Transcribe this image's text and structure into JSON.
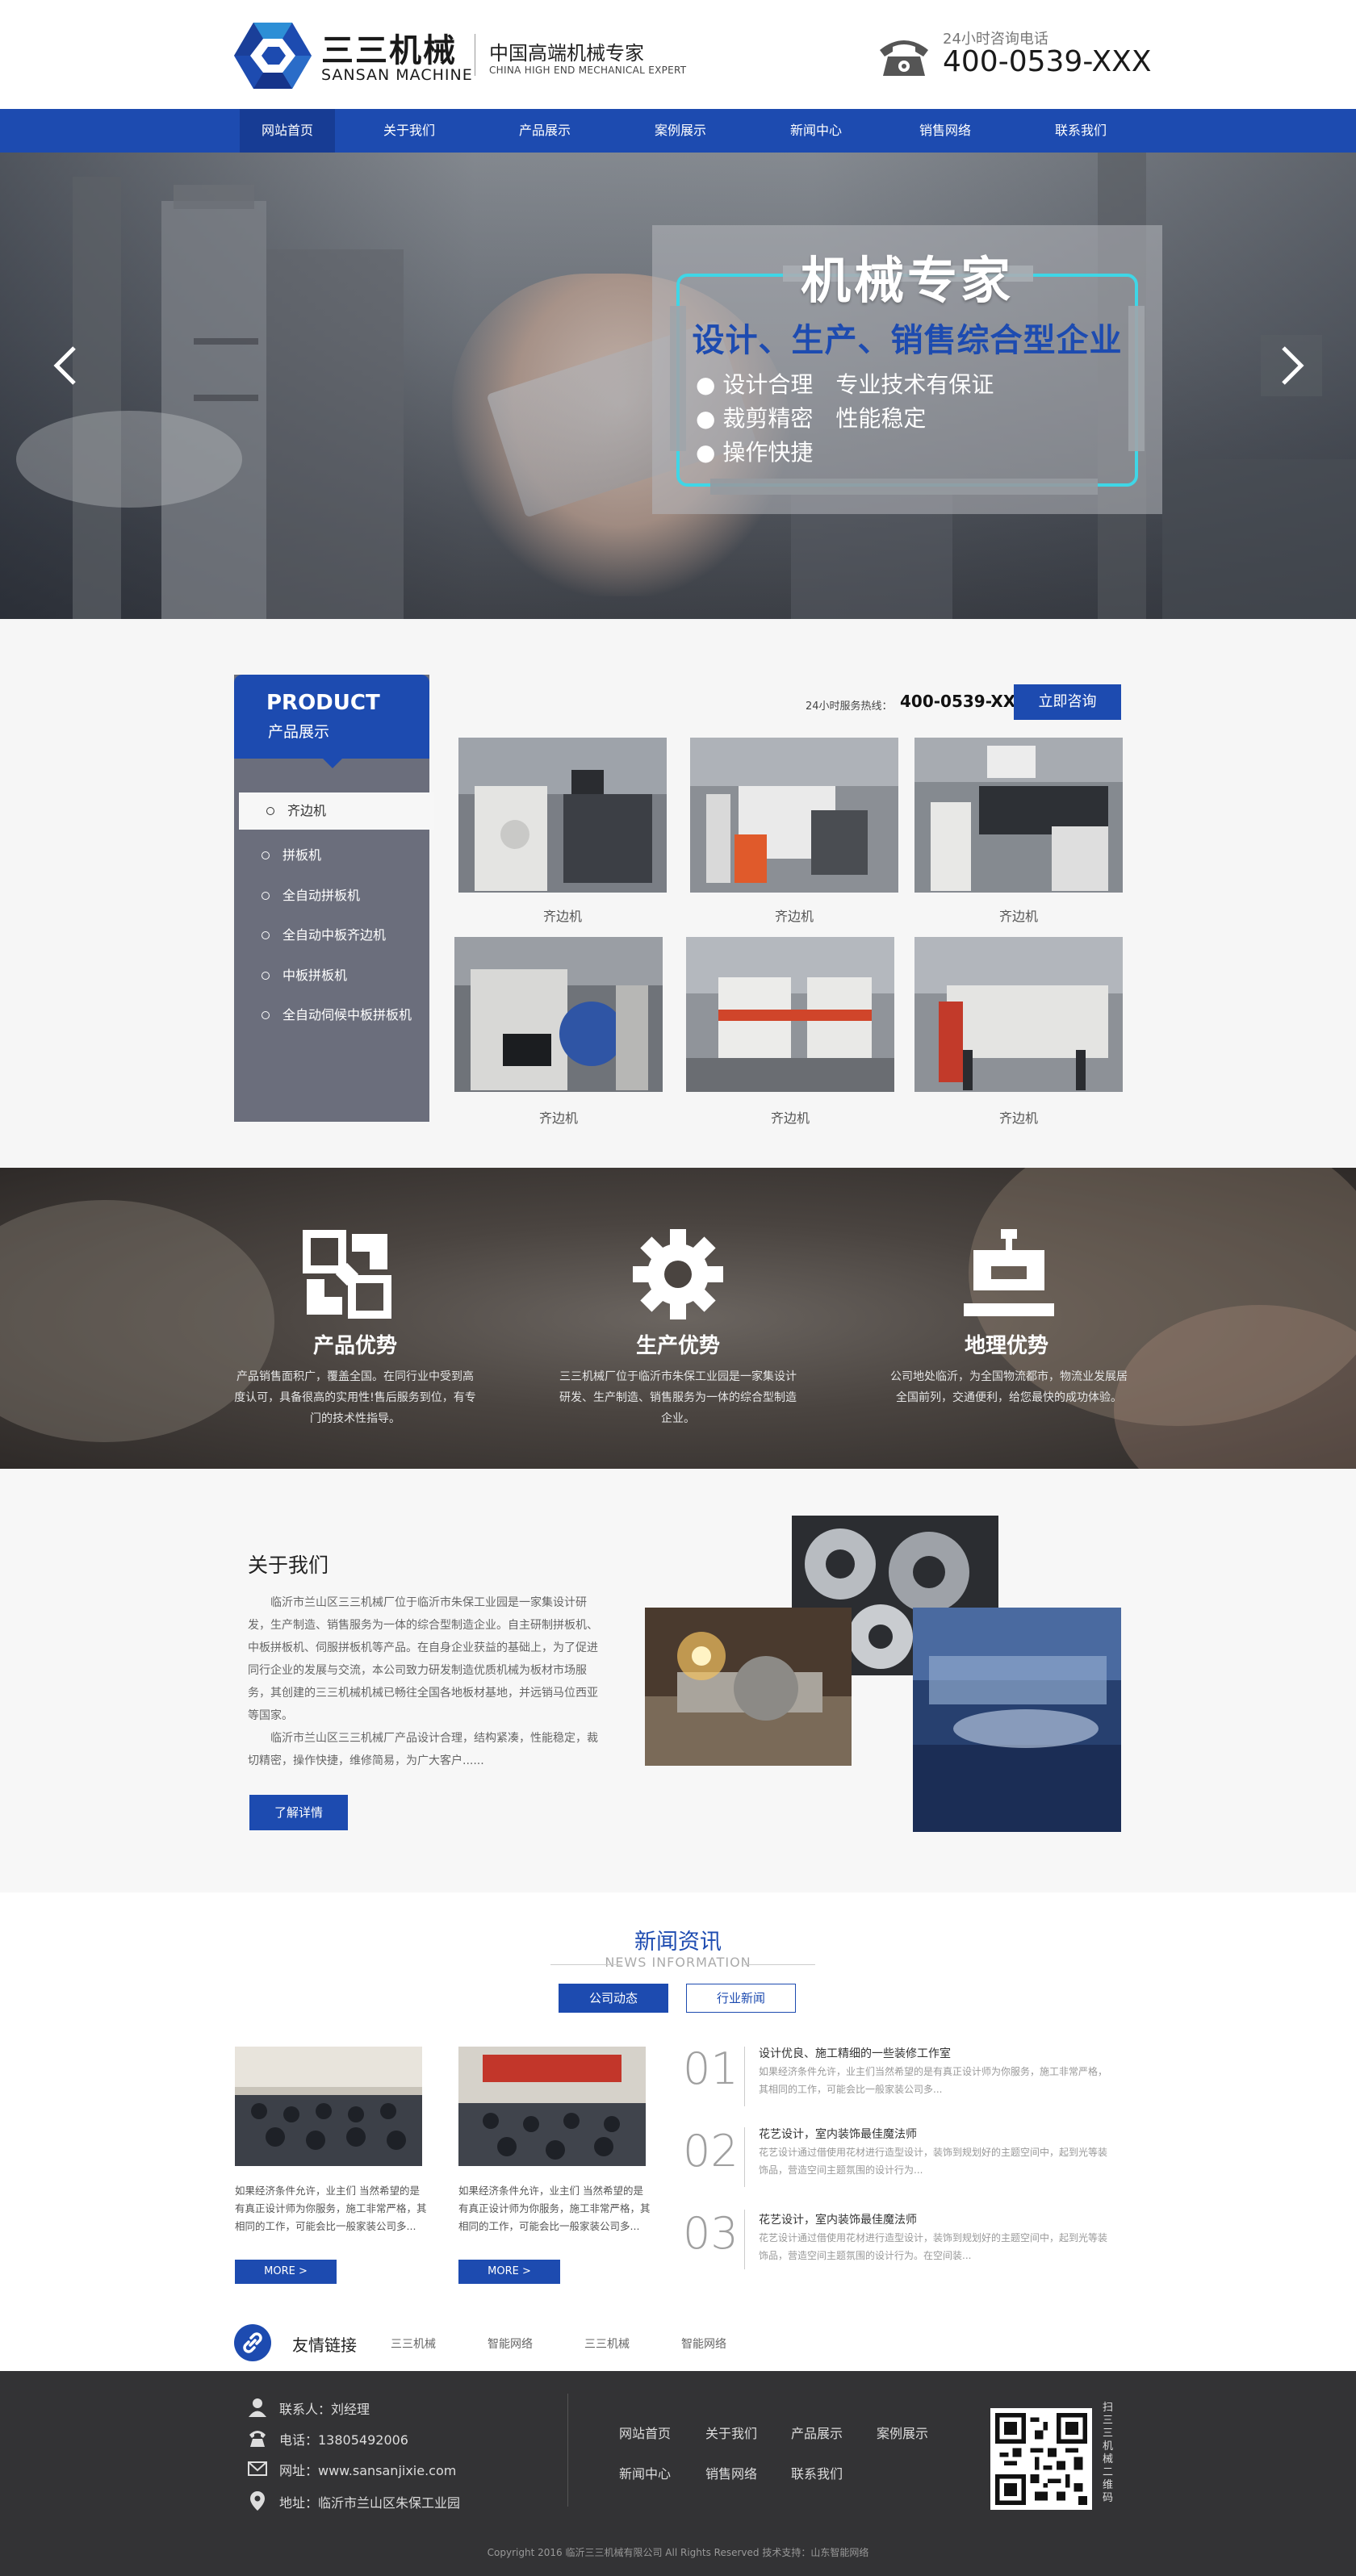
{
  "header": {
    "brand_cn": "三三机械",
    "brand_en": "SANSAN MACHINE",
    "slogan_cn": "中国高端机械专家",
    "slogan_en": "CHINA HIGH END MECHANICAL EXPERT",
    "hotline_label": "24小时咨询电话",
    "hotline_number": "400-0539-XXX"
  },
  "nav": {
    "items": [
      {
        "label": "网站首页",
        "active": true
      },
      {
        "label": "关于我们"
      },
      {
        "label": "产品展示"
      },
      {
        "label": "案例展示"
      },
      {
        "label": "新闻中心"
      },
      {
        "label": "销售网络"
      },
      {
        "label": "联系我们"
      }
    ]
  },
  "banner": {
    "title": "机械专家",
    "subtitle": "设计、生产、销售综合型企业",
    "bullets": [
      "● 设计合理　专业技术有保证",
      "● 裁剪精密　性能稳定",
      "● 操作快捷"
    ]
  },
  "products": {
    "side_title_en": "PRODUCT",
    "side_title_cn": "产品展示",
    "categories": [
      "齐边机",
      "拼板机",
      "全自动拼板机",
      "全自动中板齐边机",
      "中板拼板机",
      "全自动伺候中板拼板机"
    ],
    "service_label": "24小时服务热线：",
    "service_number": "400-0539-XXX",
    "consult_button": "立即咨询",
    "items": [
      {
        "caption": "齐边机"
      },
      {
        "caption": "齐边机"
      },
      {
        "caption": "齐边机"
      },
      {
        "caption": "齐边机"
      },
      {
        "caption": "齐边机"
      },
      {
        "caption": "齐边机"
      }
    ]
  },
  "advantages": [
    {
      "icon": "product-advantage-icon",
      "title": "产品优势",
      "text": "产品销售面积广，覆盖全国。在同行业中受到高度认可，具备很高的实用性!售后服务到位，有专门的技术性指导。"
    },
    {
      "icon": "gear-icon",
      "title": "生产优势",
      "text": "三三机械厂位于临沂市朱保工业园是一家集设计研发、生产制造、销售服务为一体的综合型制造企业。"
    },
    {
      "icon": "location-icon",
      "title": "地理优势",
      "text": "公司地处临沂，为全国物流都市，物流业发展居全国前列，交通便利，给您最快的成功体验。"
    }
  ],
  "about": {
    "title": "关于我们",
    "para1": "临沂市兰山区三三机械厂位于临沂市朱保工业园是一家集设计研发，生产制造、销售服务为一体的综合型制造企业。自主研制拼板机、中板拼板机、伺服拼板机等产品。在自身企业获益的基础上，为了促进同行企业的发展与交流，本公司致力研发制造优质机械为板材市场服务，其创建的三三机械机械已畅往全国各地板材基地，并远销马位西亚等国家。",
    "para2": "临沂市兰山区三三机械厂产品设计合理，结构紧凑，性能稳定，裁切精密，操作快捷，维修简易，为广大客户......",
    "button": "了解详情"
  },
  "news": {
    "title": "新闻资讯",
    "subtitle": "NEWS INFORMATION",
    "tabs": [
      "公司动态",
      "行业新闻"
    ],
    "cards": [
      {
        "text": "如果经济条件允许，业主们 当然希望的是有真正设计师为你服务，施工非常严格，其相同的工作，可能会比一般家装公司多...",
        "more": "MORE >"
      },
      {
        "text": "如果经济条件允许，业主们 当然希望的是有真正设计师为你服务，施工非常严格，其相同的工作，可能会比一般家装公司多...",
        "more": "MORE >"
      }
    ],
    "list": [
      {
        "num": "01",
        "title": "设计优良、施工精细的一些装修工作室",
        "summary": "如果经济条件允许，业主们当然希望的是有真正设计师为你服务，施工非常严格，其相同的工作，可能会比一般家装公司多..."
      },
      {
        "num": "02",
        "title": "花艺设计，室内装饰最佳魔法师",
        "summary": "花艺设计通过借使用花材进行造型设计，装饰到规划好的主题空间中，起到光等装饰品，营造空间主题氛围的设计行为..."
      },
      {
        "num": "03",
        "title": "花艺设计，室内装饰最佳魔法师",
        "summary": "花艺设计通过借使用花材进行造型设计，装饰到规划好的主题空间中，起到光等装饰品，营造空间主题氛围的设计行为。在空间装..."
      }
    ]
  },
  "friend_links": {
    "title": "友情链接",
    "links": [
      "三三机械",
      "智能网络",
      "三三机械",
      "智能网络"
    ]
  },
  "footer": {
    "contact": "联系人：刘经理",
    "phone": "电话：13805492006",
    "website": "网址：www.sansanjixie.com",
    "address": "地址：临沂市兰山区朱保工业园",
    "nav_row1": [
      "网站首页",
      "关于我们",
      "产品展示",
      "案例展示"
    ],
    "nav_row2": [
      "新闻中心",
      "销售网络",
      "联系我们"
    ],
    "qr_label": "扫三三机械二维码",
    "copyright": "Copyright 2016 临沂三三机械有限公司 All Rights Reserved   技术支持：山东智能网络"
  },
  "colors": {
    "brand_blue": "#1d4bb0",
    "banner_accent": "#3fd6e6",
    "footer_bg": "#333335"
  }
}
